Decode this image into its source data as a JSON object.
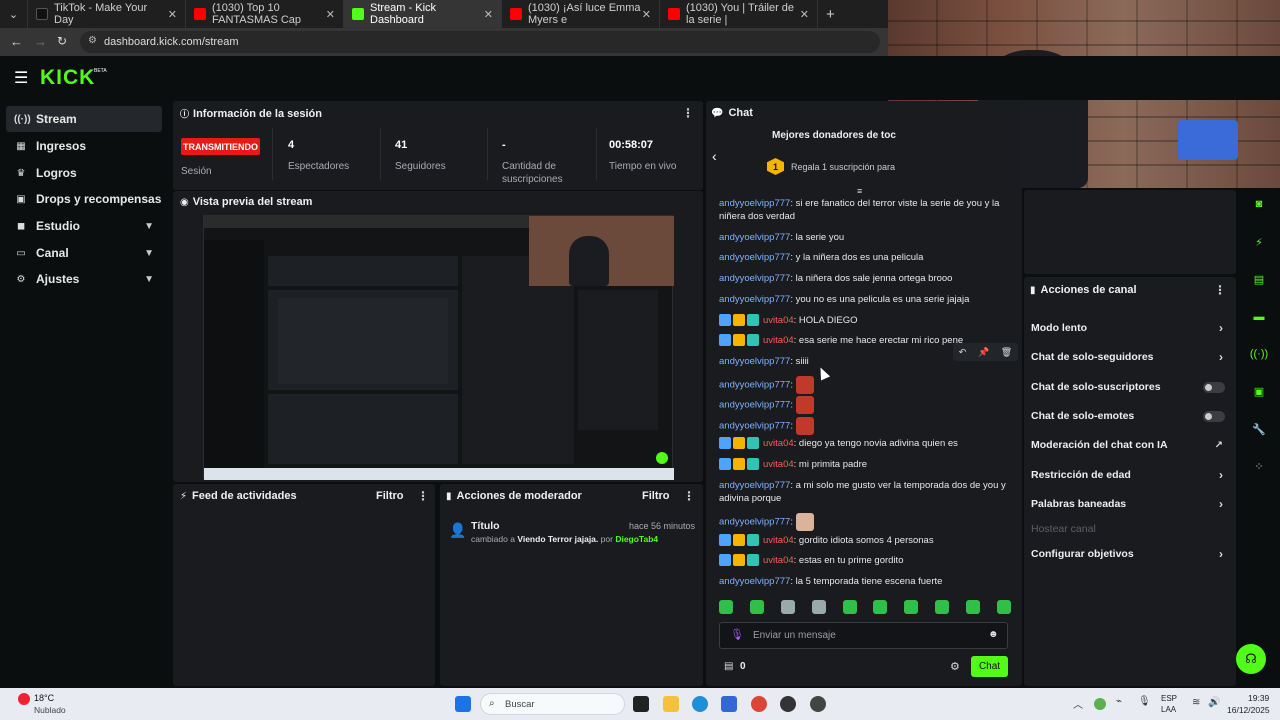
{
  "browser": {
    "tabs": [
      {
        "label": "TikTok - Make Your Day",
        "color": "#111111"
      },
      {
        "label": "(1030) Top 10 FANTASMAS Cap",
        "color": "#ff0000"
      },
      {
        "label": "Stream - Kick Dashboard",
        "color": "#53fc18"
      },
      {
        "label": "(1030) ¡Así luce Emma Myers e",
        "color": "#ff0000"
      },
      {
        "label": "(1030) You | Tráiler de la serie |",
        "color": "#ff0000"
      }
    ],
    "new_tab": "+",
    "url": "dashboard.kick.com/stream"
  },
  "header": {
    "logo": "KICK",
    "beta": "BETA"
  },
  "sidebar": {
    "items": [
      {
        "label": "Stream",
        "icon": "stream-icon"
      },
      {
        "label": "Ingresos",
        "icon": "revenue-icon"
      },
      {
        "label": "Logros",
        "icon": "trophy-icon"
      },
      {
        "label": "Drops y recompensas",
        "icon": "gift-icon"
      },
      {
        "label": "Estudio",
        "icon": "studio-icon"
      },
      {
        "label": "Canal",
        "icon": "channel-icon"
      },
      {
        "label": "Ajustes",
        "icon": "gear-icon"
      }
    ]
  },
  "session": {
    "title": "Información de la sesión",
    "status": "TRANSMITIENDO",
    "status_label": "Sesión",
    "stats": [
      {
        "value": "4",
        "label": "Espectadores"
      },
      {
        "value": "41",
        "label": "Seguidores"
      },
      {
        "value": "-",
        "label": "Cantidad de suscripciones"
      },
      {
        "value": "00:58:07",
        "label": "Tiempo en vivo"
      }
    ]
  },
  "preview": {
    "title": "Vista previa del stream"
  },
  "activity": {
    "title": "Feed de actividades",
    "filter": "Filtro"
  },
  "modactions": {
    "title": "Acciones de moderador",
    "filter": "Filtro",
    "entry_title": "Título",
    "entry_time": "hace 56 minutos",
    "entry_prefix": "cambiado a",
    "entry_value": "Viendo Terror jajaja.",
    "entry_by": "por",
    "entry_user": "DiegoTab4"
  },
  "chat": {
    "title": "Chat",
    "donors_title": "Mejores donadores de toc",
    "donor_rank": "1",
    "donor_text": "Regala 1 suscripción para",
    "messages": [
      {
        "user": "andyyoelvipp777",
        "text": ": si ere fanatico del terror viste la serie de you y la niñera dos verdad"
      },
      {
        "user": "andyyoelvipp777",
        "text": ": la serie you"
      },
      {
        "user": "andyyoelvipp777",
        "text": ": y la niñera dos es una pelicula"
      },
      {
        "user": "andyyoelvipp777",
        "text": ": la niñera dos sale jenna ortega brooo"
      },
      {
        "user": "andyyoelvipp777",
        "text": ": you no es una pelicula es una serie jajaja"
      },
      {
        "user": "uvita04",
        "text": ": HOLA DIEGO"
      },
      {
        "user": "uvita04",
        "text": ": esa serie me hace erectar mi rico pene"
      },
      {
        "user": "andyyoelvipp777",
        "text": ": siiii"
      },
      {
        "user": "andyyoelvipp777",
        "text": ":"
      },
      {
        "user": "andyyoelvipp777",
        "text": ":"
      },
      {
        "user": "andyyoelvipp777",
        "text": ":"
      },
      {
        "user": "uvita04",
        "text": ": diego ya tengo novia adivina quien es"
      },
      {
        "user": "uvita04",
        "text": ": mi primita padre"
      },
      {
        "user": "andyyoelvipp777",
        "text": ": a mi solo me gusto ver la temporada dos de you y adivina porque"
      },
      {
        "user": "andyyoelvipp777",
        "text": ":"
      },
      {
        "user": "uvita04",
        "text": ": gordito idiota somos 4 personas"
      },
      {
        "user": "uvita04",
        "text": ": estas en tu prime gordito"
      },
      {
        "user": "andyyoelvipp777",
        "text": ": la 5 temporada tiene escena fuerte"
      }
    ],
    "input_placeholder": "Enviar un mensaje",
    "points": "0",
    "send_label": "Chat"
  },
  "channel_actions": {
    "title": "Acciones de canal",
    "items": [
      {
        "label": "Modo lento",
        "control": "chevron"
      },
      {
        "label": "Chat de solo-seguidores",
        "control": "chevron"
      },
      {
        "label": "Chat de solo-suscriptores",
        "control": "toggle"
      },
      {
        "label": "Chat de solo-emotes",
        "control": "toggle"
      },
      {
        "label": "Moderación del chat con IA",
        "control": "link"
      },
      {
        "label": "Restricción de edad",
        "control": "chevron"
      },
      {
        "label": "Palabras baneadas",
        "control": "chevron"
      },
      {
        "label": "Hostear canal",
        "control": "none"
      },
      {
        "label": "Configurar objetivos",
        "control": "chevron"
      }
    ]
  },
  "taskbar": {
    "weather_temp": "18°C",
    "weather_desc": "Nublado",
    "search": "Buscar",
    "lang": "ESP",
    "lang2": "LAA",
    "time": "19:39",
    "date": "16/12/2025"
  },
  "colors": {
    "accent": "#53fc18",
    "live": "#e91916",
    "panel": "#191b1f"
  }
}
